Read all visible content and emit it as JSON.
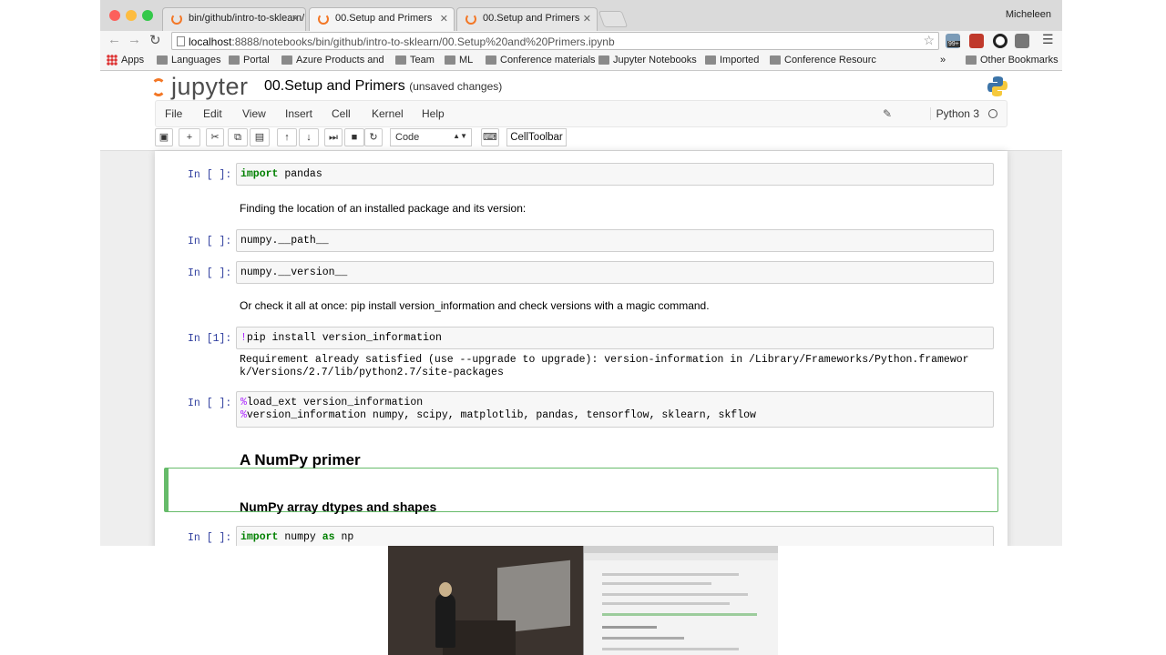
{
  "browser": {
    "tabs": [
      {
        "label": "bin/github/intro-to-sklearn/"
      },
      {
        "label": "00.Setup and Primers"
      },
      {
        "label": "00.Setup and Primers"
      }
    ],
    "user": "Micheleen",
    "url_host": "localhost",
    "url_rest": ":8888/notebooks/bin/github/intro-to-sklearn/00.Setup%20and%20Primers.ipynb",
    "ext_badge": "99+",
    "bookmarks": [
      "Apps",
      "Languages",
      "Portal",
      "Azure Products and",
      "Team",
      "ML",
      "Conference materials",
      "Jupyter Notebooks",
      "Imported",
      "Conference Resourc"
    ],
    "bookmarks_more": "»",
    "other_bookmarks": "Other Bookmarks"
  },
  "jupyter": {
    "logo": "jupyter",
    "notebook_title": "00.Setup and Primers",
    "save_status": "(unsaved changes)",
    "menu": [
      "File",
      "Edit",
      "View",
      "Insert",
      "Cell",
      "Kernel",
      "Help"
    ],
    "kernel": "Python 3",
    "toolbar": {
      "cell_type": "Code",
      "celltoolbar": "CellToolbar"
    }
  },
  "cells": {
    "c1": {
      "prompt": "In [ ]:",
      "kw": "import",
      "rest": " pandas"
    },
    "md1": "Finding the location of an installed package and its version:",
    "c2": {
      "prompt": "In [ ]:",
      "code": "numpy.__path__"
    },
    "c3": {
      "prompt": "In [ ]:",
      "code": "numpy.__version__"
    },
    "md2": "Or check it all at once: pip install version_information and check versions with a magic command.",
    "c4": {
      "prompt": "In [1]:",
      "bang": "!",
      "code": "pip install version_information"
    },
    "c4_out": "Requirement already satisfied (use --upgrade to upgrade): version-information in /Library/Frameworks/Python.framewor\nk/Versions/2.7/lib/python2.7/site-packages",
    "c5": {
      "prompt": "In [ ]:",
      "line1_magic": "%",
      "line1_code": "load_ext version_information",
      "line2_magic": "%",
      "line2_code": "version_information numpy, scipy, matplotlib, pandas, tensorflow, sklearn, skflow"
    },
    "h1": "A NumPy primer",
    "h2": "NumPy array dtypes and shapes",
    "c6": {
      "prompt": "In [ ]:",
      "kw1": "import",
      "mid": " numpy ",
      "kw2": "as",
      "rest": " np"
    }
  },
  "colors": {
    "prompt": "#303f9f",
    "keyword": "#008000",
    "magic": "#aa22ff",
    "selected_border": "#66bb6a",
    "jupyter_orange": "#f37726"
  }
}
